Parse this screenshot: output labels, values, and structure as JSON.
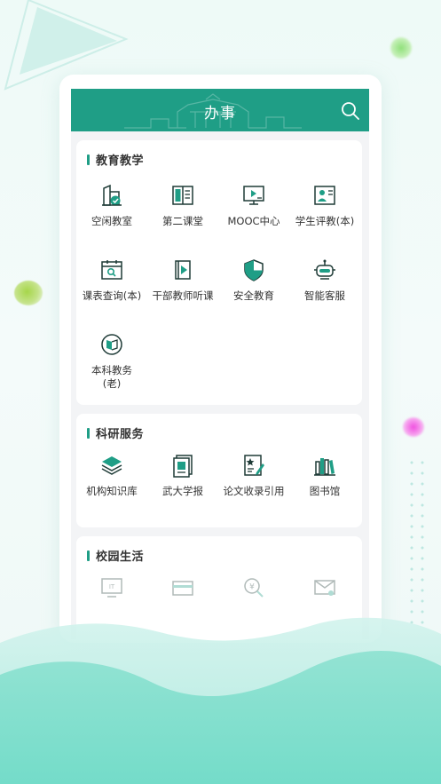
{
  "colors": {
    "accent": "#1f9e86",
    "wave_light": "#b9ece2",
    "wave_dark": "#7ddfcd",
    "background": "#eefaf7"
  },
  "header": {
    "title": "办事",
    "search_icon": "search-icon"
  },
  "sections": [
    {
      "title": "教育教学",
      "items": [
        {
          "label": "空闲教室",
          "icon": "building-check-icon"
        },
        {
          "label": "第二课堂",
          "icon": "open-book-icon"
        },
        {
          "label": "MOOC中心",
          "icon": "monitor-play-icon"
        },
        {
          "label": "学生评教(本)",
          "icon": "person-card-icon"
        },
        {
          "label": "课表查询(本)",
          "icon": "calendar-search-icon"
        },
        {
          "label": "干部教师听课",
          "icon": "play-book-icon"
        },
        {
          "label": "安全教育",
          "icon": "shield-icon"
        },
        {
          "label": "智能客服",
          "icon": "robot-icon"
        },
        {
          "label": "本科教务\n(老)",
          "icon": "book-circle-icon"
        }
      ]
    },
    {
      "title": "科研服务",
      "items": [
        {
          "label": "机构知识库",
          "icon": "layers-icon"
        },
        {
          "label": "武大学报",
          "icon": "journal-icon"
        },
        {
          "label": "论文收录引用",
          "icon": "paper-star-icon"
        },
        {
          "label": "图书馆",
          "icon": "bookshelf-icon"
        }
      ]
    },
    {
      "title": "校园生活",
      "items": [
        {
          "label": "",
          "icon": "it-monitor-icon"
        },
        {
          "label": "",
          "icon": "card-icon"
        },
        {
          "label": "",
          "icon": "yen-search-icon"
        },
        {
          "label": "",
          "icon": "mail-person-icon"
        }
      ]
    }
  ]
}
